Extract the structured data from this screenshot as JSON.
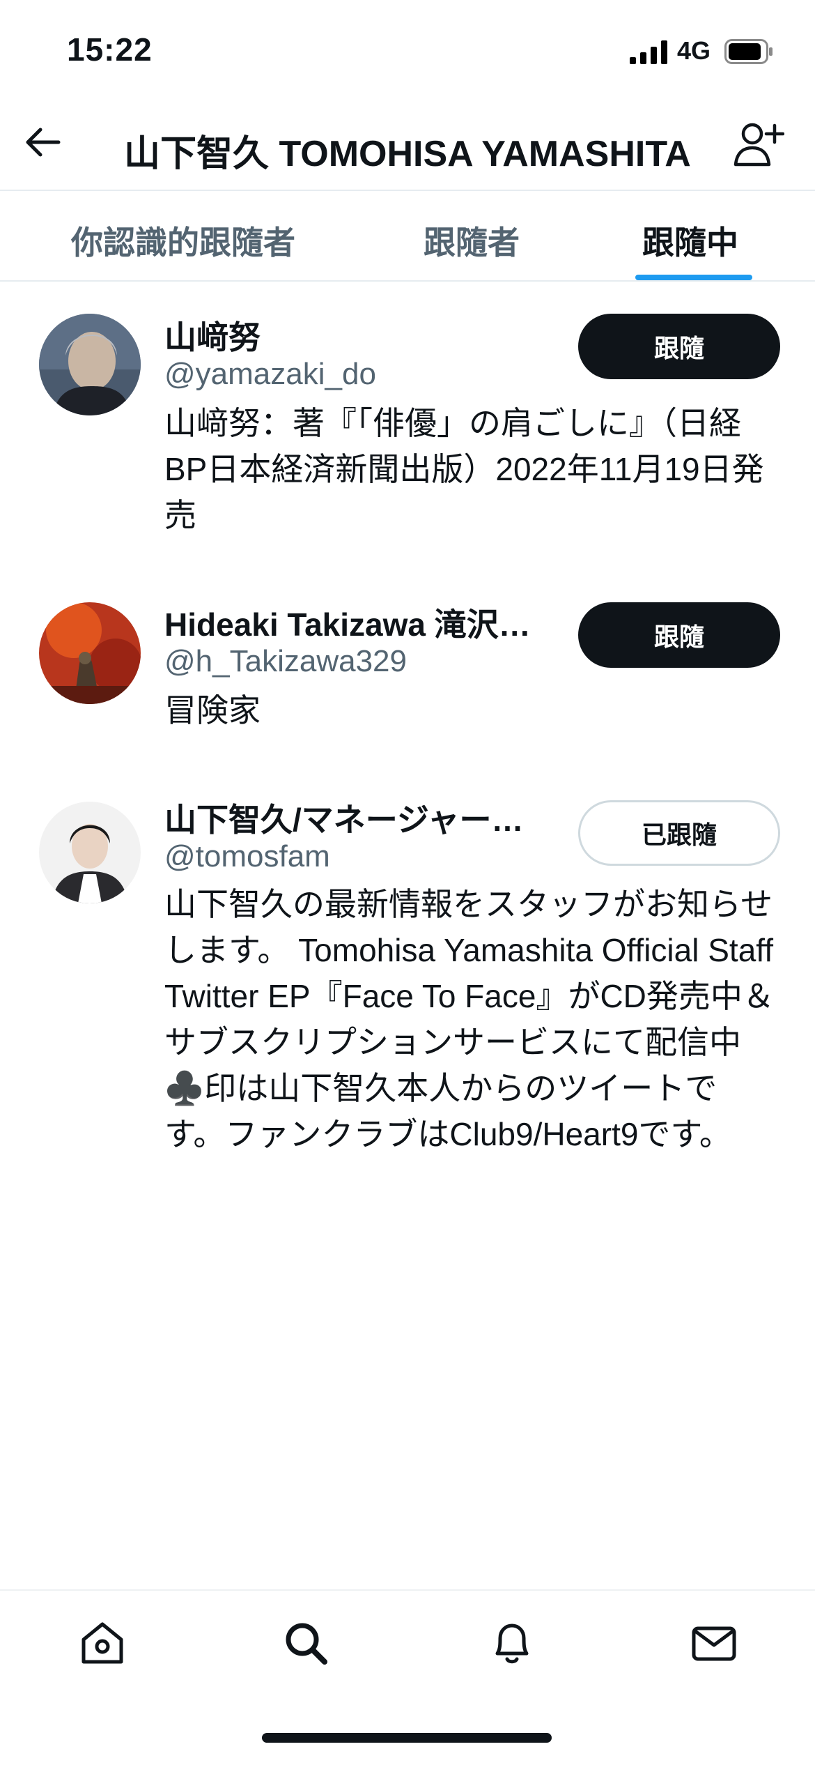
{
  "status_bar": {
    "time": "15:22",
    "network": "4G"
  },
  "header": {
    "title": "山下智久 TOMOHISA YAMASHITA"
  },
  "tabs": [
    {
      "label": "你認識的跟隨者"
    },
    {
      "label": "跟隨者"
    },
    {
      "label": "跟隨中"
    }
  ],
  "users": [
    {
      "name": "山﨑努",
      "handle": "@yamazaki_do",
      "bio": "山﨑努：著『「俳優」の肩ごしに』（日経BP日本経済新聞出版）2022年11月19日発売",
      "button": "跟隨"
    },
    {
      "name": "Hideaki Takizawa 滝沢…",
      "handle": "@h_Takizawa329",
      "bio": "冒険家",
      "button": "跟隨"
    },
    {
      "name": "山下智久/マネージャー…",
      "handle": "@tomosfam",
      "bio": "山下智久の最新情報をスタッフがお知らせします。 Tomohisa Yamashita Official Staff Twitter EP『Face To Face』がCD発売中＆サブスクリプションサービスにて配信中 ♣️印は山下智久本人からのツイートです。ファンクラブはClub9/Heart9です。",
      "button": "已跟隨"
    }
  ],
  "bottom_nav": {
    "icons": [
      "home-icon",
      "search-icon",
      "bell-icon",
      "mail-icon"
    ]
  },
  "colors": {
    "accent": "#1d9bf0",
    "text": "#0f1419",
    "secondary": "#536471",
    "button_dark": "#0f1419"
  }
}
